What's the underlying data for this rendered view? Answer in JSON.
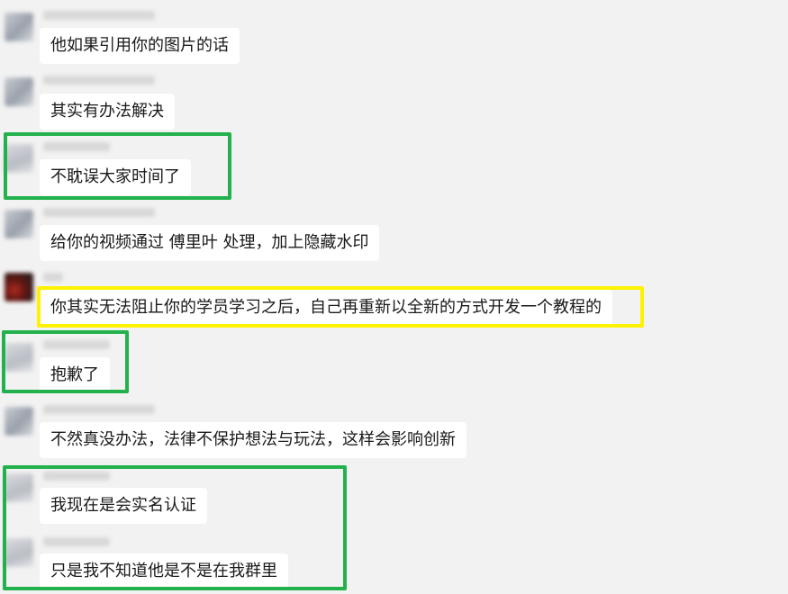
{
  "messages": [
    {
      "id": "m1",
      "text": "他如果引用你的图片的话"
    },
    {
      "id": "m2",
      "text": "其实有办法解决"
    },
    {
      "id": "m3",
      "text": "不耽误大家时间了"
    },
    {
      "id": "m4",
      "text": "给你的视频通过 傅里叶 处理，加上隐藏水印"
    },
    {
      "id": "m5",
      "text": "你其实无法阻止你的学员学习之后，自己再重新以全新的方式开发一个教程的"
    },
    {
      "id": "m6",
      "text": "抱歉了"
    },
    {
      "id": "m7",
      "text": "不然真没办法，法律不保护想法与玩法，这样会影响创新"
    },
    {
      "id": "m8",
      "text": "我现在是会实名认证"
    },
    {
      "id": "m9",
      "text": "只是我不知道他是不是在我群里"
    }
  ],
  "highlights": [
    {
      "label": "green-highlight",
      "color": "#22b14c"
    },
    {
      "label": "yellow-highlight",
      "color": "#fff200"
    }
  ]
}
